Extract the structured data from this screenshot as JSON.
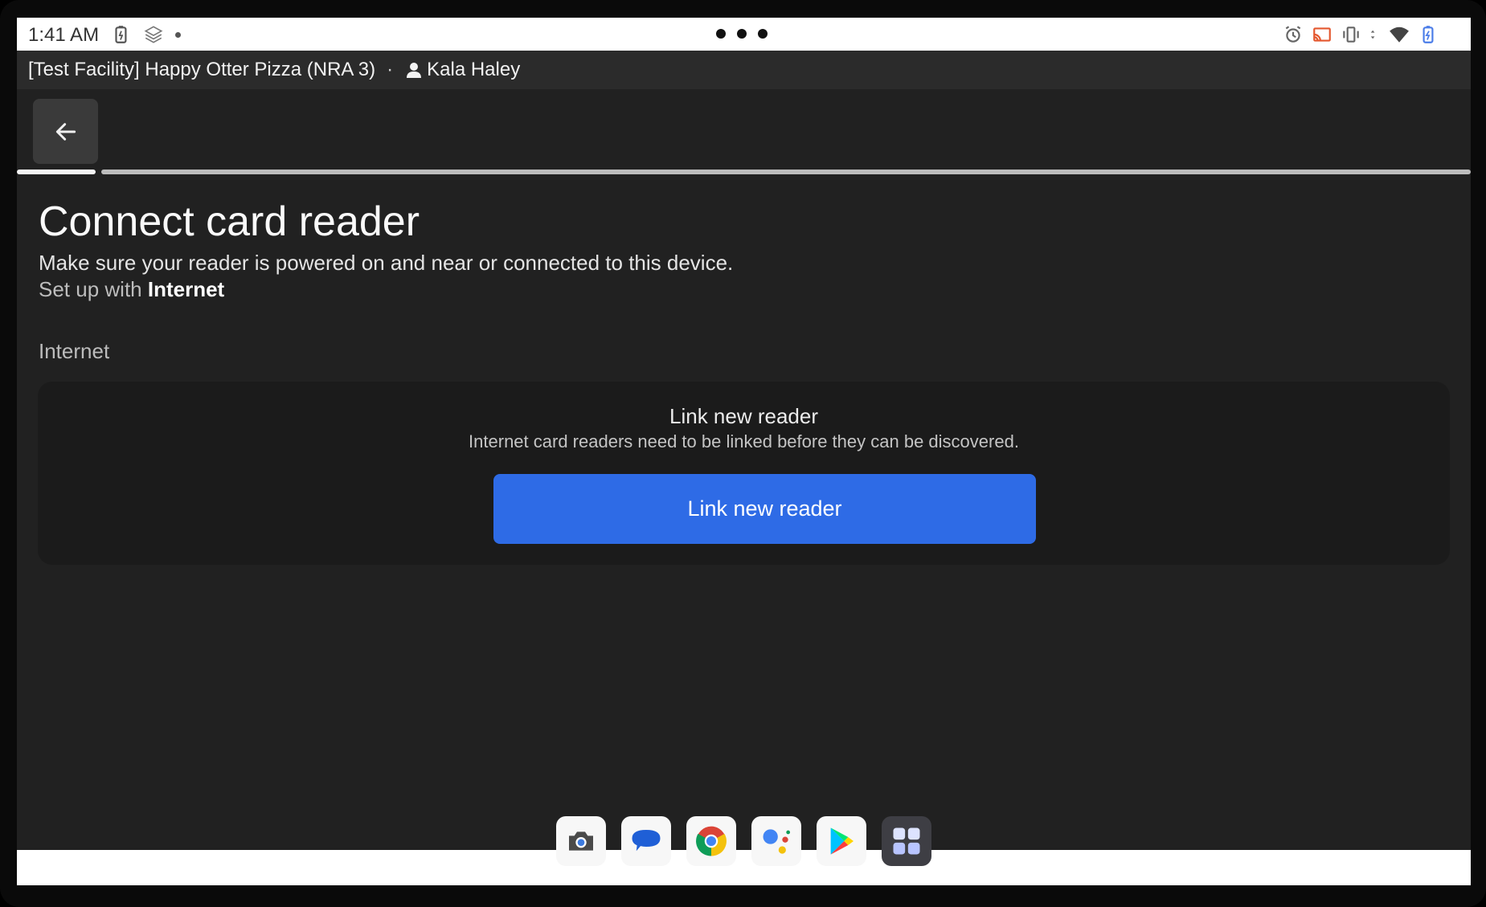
{
  "status_bar": {
    "time": "1:41 AM",
    "left_icons": [
      "battery-saver-icon",
      "layers-icon",
      "notification-dot"
    ],
    "right_icons": [
      "alarm-icon",
      "cast-icon",
      "vibrate-icon",
      "data-arrows-icon",
      "wifi-icon",
      "battery-charging-icon"
    ]
  },
  "app_header": {
    "facility": "[Test Facility] Happy Otter Pizza (NRA 3)",
    "separator": "·",
    "user_name": "Kala Haley"
  },
  "page": {
    "title": "Connect card reader",
    "subtitle": "Make sure your reader is powered on and near or connected to this device.",
    "setup_prefix": "Set up with",
    "setup_method": "Internet",
    "section_label": "Internet"
  },
  "card": {
    "title": "Link new reader",
    "description": "Internet card readers need to be linked before they can be discovered.",
    "button_label": "Link new reader"
  },
  "progress": {
    "current_step": 1,
    "total_steps": 2
  },
  "colors": {
    "accent": "#2e6be6",
    "background": "#212121",
    "card": "#1b1b1b"
  },
  "dock": {
    "apps": [
      "camera-app-icon",
      "messages-app-icon",
      "chrome-app-icon",
      "assistant-app-icon",
      "play-store-app-icon",
      "app-drawer-icon"
    ]
  }
}
